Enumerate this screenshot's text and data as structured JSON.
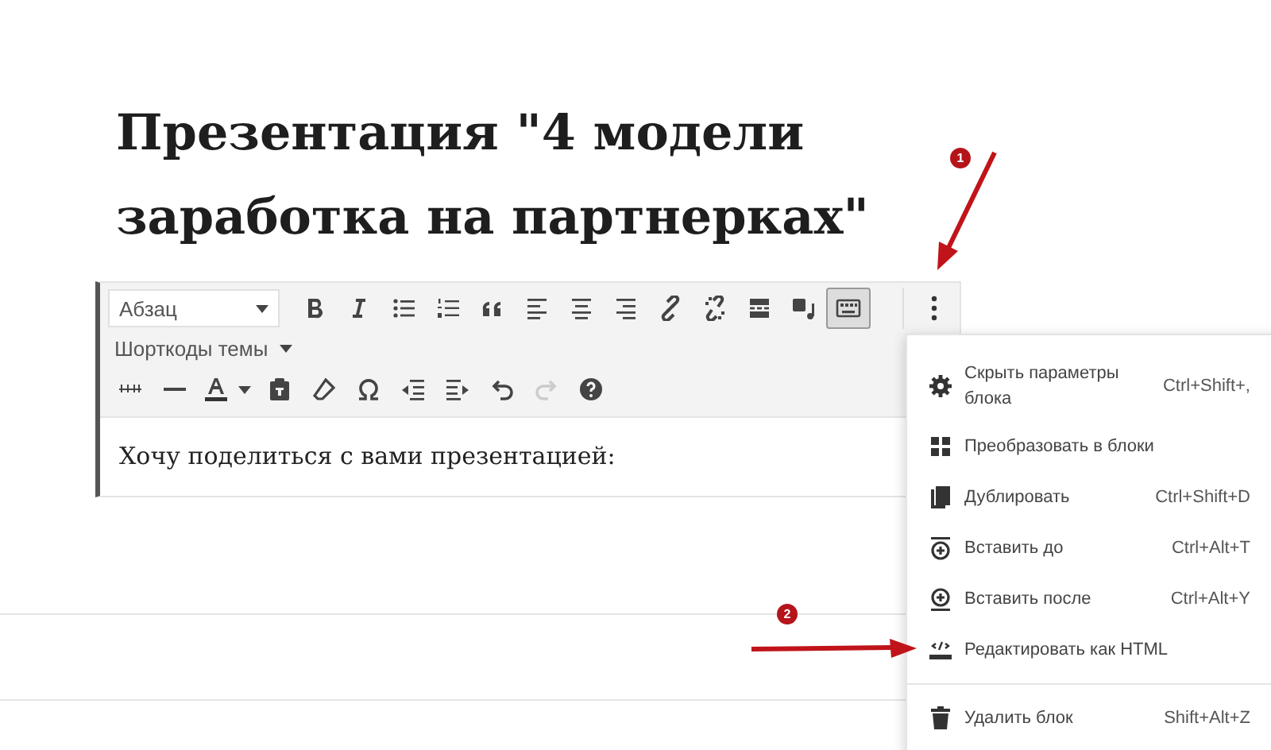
{
  "title": "Презентация \"4 модели заработка на партнерках\"",
  "editor": {
    "format_select": "Абзац",
    "shortcodes_menu": "Шорткоды темы",
    "toolbar_toggle": {
      "on": true
    },
    "redo": {
      "disabled": true
    },
    "content": "Хочу поделиться с вами презентацией:"
  },
  "block_menu": {
    "items": [
      {
        "label": "Скрыть параметры блока",
        "shortcut": "Ctrl+Shift+,",
        "divider_before": false
      },
      {
        "label": "Преобразовать в блоки",
        "divider_before": false
      },
      {
        "label": "Дублировать",
        "shortcut": "Ctrl+Shift+D",
        "divider_before": false
      },
      {
        "label": "Вставить до",
        "shortcut": "Ctrl+Alt+T",
        "divider_before": false
      },
      {
        "label": "Вставить после",
        "shortcut": "Ctrl+Alt+Y",
        "divider_before": false
      },
      {
        "label": "Редактировать как HTML",
        "divider_before": false
      },
      {
        "label": "Удалить блок",
        "shortcut": "Shift+Alt+Z",
        "divider_before": true
      }
    ]
  },
  "callouts": [
    "1",
    "2"
  ]
}
